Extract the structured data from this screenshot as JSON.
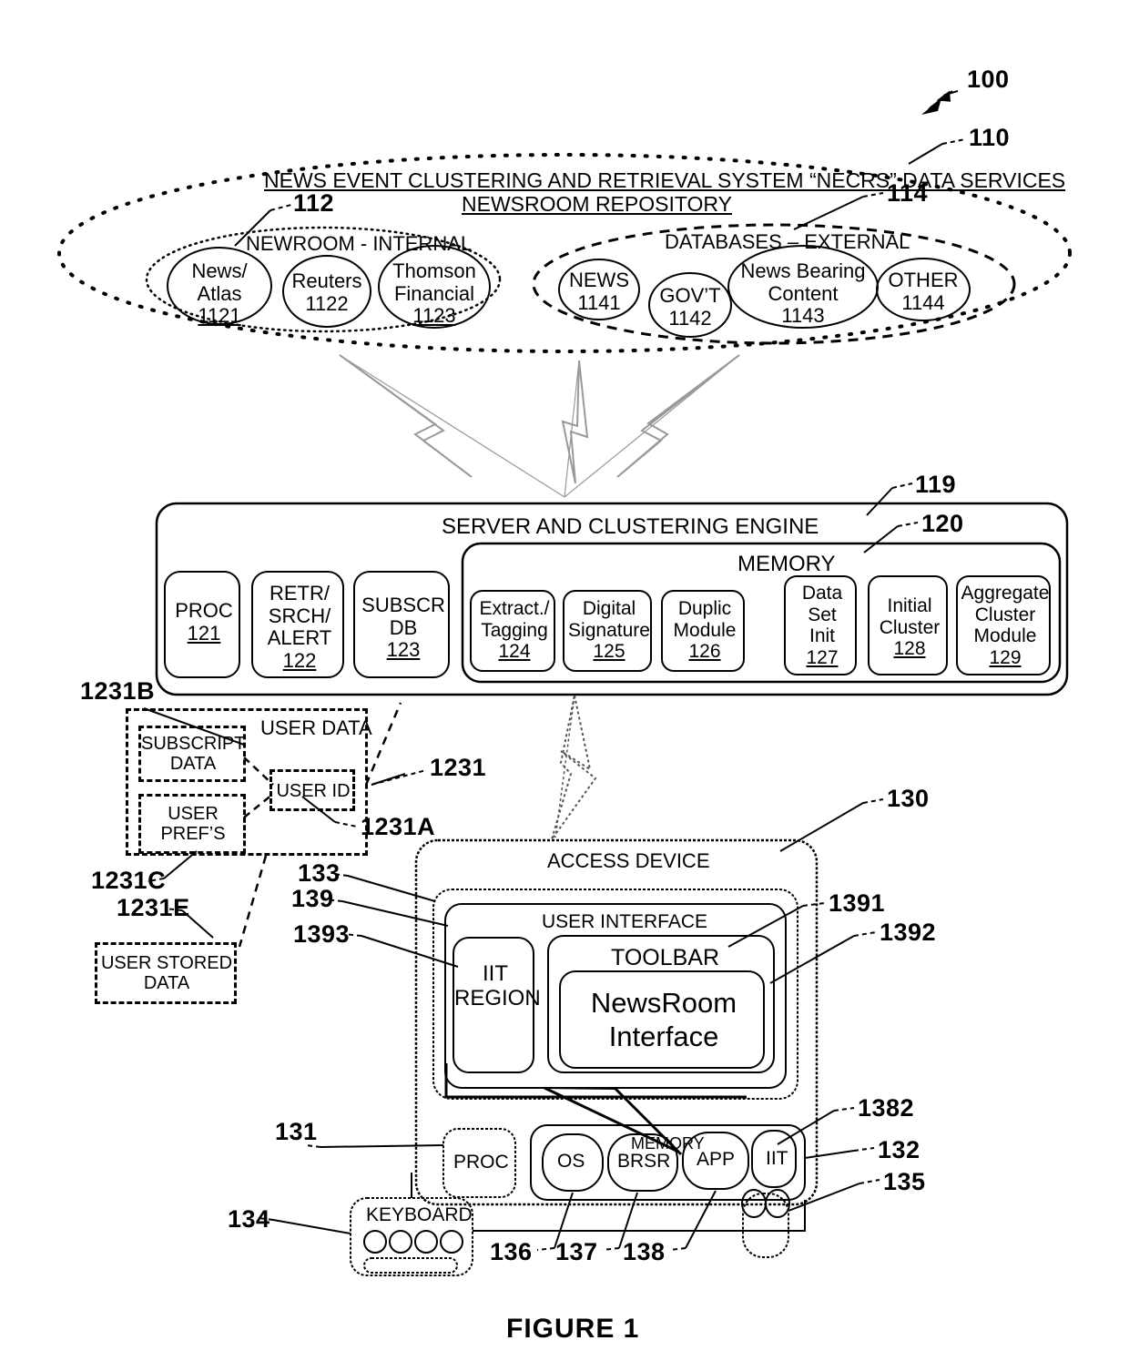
{
  "figure": {
    "caption": "FIGURE 1",
    "system_ref": "100"
  },
  "data_services": {
    "ref": "110",
    "title_line1": "NEWS EVENT CLUSTERING AND RETRIEVAL SYSTEM “NECRS” DATA SERVICES",
    "title_line2": "NEWSROOM REPOSITORY",
    "internal": {
      "ref": "112",
      "label": "NEWROOM - INTERNAL",
      "sources": [
        {
          "name_line1": "News/",
          "name_line2": "Atlas",
          "ref": "1121"
        },
        {
          "name_line1": "Reuters",
          "name_line2": "",
          "ref": "1122"
        },
        {
          "name_line1": "Thomson",
          "name_line2": "Financial",
          "ref": "1123"
        }
      ]
    },
    "external": {
      "ref": "114",
      "label": "DATABASES – EXTERNAL",
      "sources": [
        {
          "name_line1": "NEWS",
          "name_line2": "",
          "ref": "1141"
        },
        {
          "name_line1": "GOV’T",
          "name_line2": "",
          "ref": "1142"
        },
        {
          "name_line1": "News Bearing",
          "name_line2": "Content",
          "ref": "1143"
        },
        {
          "name_line1": "OTHER",
          "name_line2": "",
          "ref": "1144"
        }
      ]
    }
  },
  "server": {
    "ref": "119",
    "title": "SERVER AND CLUSTERING ENGINE",
    "components": [
      {
        "lines": [
          "PROC"
        ],
        "ref": "121"
      },
      {
        "lines": [
          "RETR/",
          "SRCH/",
          "ALERT"
        ],
        "ref": "122"
      },
      {
        "lines": [
          "SUBSCR",
          "DB"
        ],
        "ref": "123"
      }
    ],
    "memory": {
      "ref": "120",
      "label": "MEMORY",
      "modules": [
        {
          "lines": [
            "Extract./",
            "Tagging"
          ],
          "ref": "124"
        },
        {
          "lines": [
            "Digital",
            "Signature"
          ],
          "ref": "125"
        },
        {
          "lines": [
            "Duplic",
            "Module"
          ],
          "ref": "126"
        },
        {
          "lines": [
            "Data",
            "Set",
            "Init"
          ],
          "ref": "127"
        },
        {
          "lines": [
            "Initial",
            "Cluster"
          ],
          "ref": "128"
        },
        {
          "lines": [
            "Aggregate",
            "Cluster",
            "Module"
          ],
          "ref": "129"
        }
      ]
    }
  },
  "user_data": {
    "ref": "1231",
    "label": "USER DATA",
    "items": [
      {
        "lines": [
          "SUBSCRIPT",
          "DATA"
        ],
        "ref": "1231B"
      },
      {
        "lines": [
          "USER",
          "PREF’S"
        ],
        "ref": "1231C"
      },
      {
        "lines": [
          "USER ID"
        ],
        "ref": "1231A"
      },
      {
        "lines": [
          "USER STORED",
          "DATA"
        ],
        "ref": "1231E"
      }
    ]
  },
  "access_device": {
    "ref": "130",
    "title": "ACCESS DEVICE",
    "ui_outer_ref": "133",
    "user_interface": {
      "ref": "139",
      "label": "USER INTERFACE",
      "iit_region": {
        "lines": [
          "IIT",
          "REGION"
        ],
        "ref": "1393"
      },
      "toolbar": {
        "label": "TOOLBAR",
        "ref": "1391"
      },
      "newsroom_interface": {
        "lines": [
          "NewsRoom",
          "Interface"
        ],
        "ref": "1392"
      }
    },
    "proc": {
      "label": "PROC",
      "ref": "131"
    },
    "memory": {
      "label": "MEMORY",
      "ref": "132",
      "modules": [
        {
          "label": "OS",
          "ref": "136"
        },
        {
          "label": "BRSR",
          "ref": "137"
        },
        {
          "label": "APP",
          "ref": "138"
        },
        {
          "label": "IIT",
          "ref": "1382"
        }
      ]
    },
    "keyboard": {
      "label": "KEYBOARD",
      "ref": "134"
    },
    "mouse": {
      "label": "",
      "ref": "135"
    }
  }
}
